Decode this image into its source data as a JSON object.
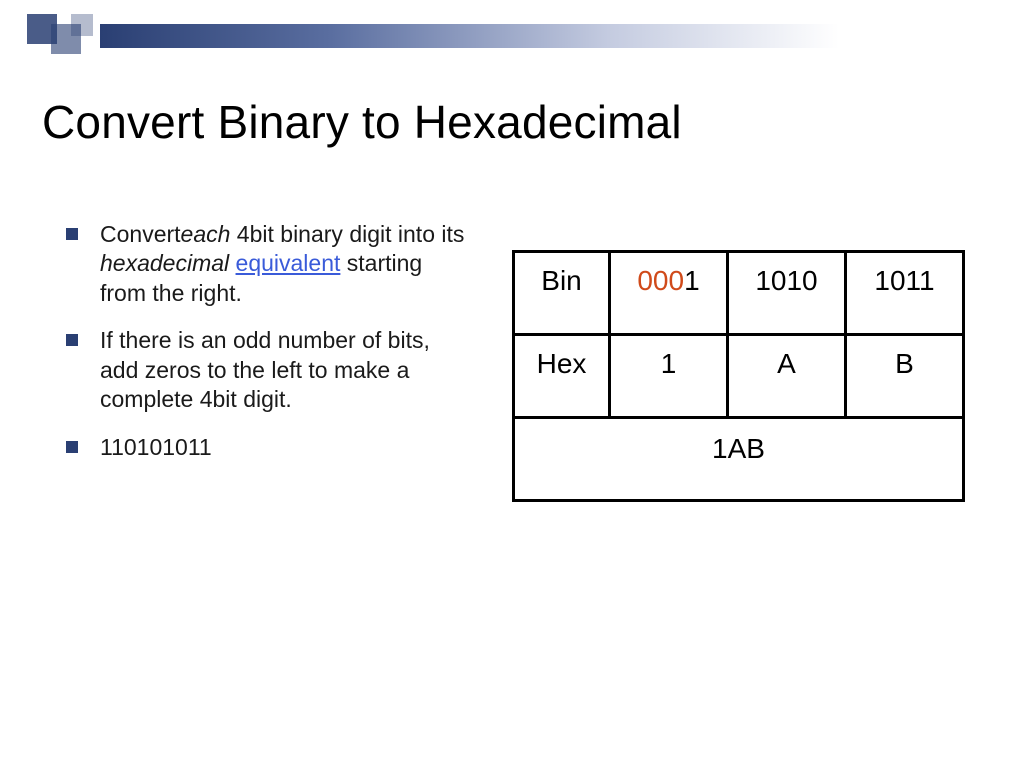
{
  "title": "Convert Binary to Hexadecimal",
  "bullets": {
    "b1": {
      "t1": "Convert",
      "t2": "each",
      "t3": " 4bit binary digit into its ",
      "t4": "hexadecimal",
      "t5": " ",
      "t6": "equivalent",
      "t7": " starting from the right."
    },
    "b2": "If there is an odd number of bits, add zeros to the left to make a complete 4bit digit.",
    "b3": "110101011"
  },
  "table": {
    "r1": {
      "label": "Bin",
      "c1_red": "000",
      "c1_rest": "1",
      "c2": "1010",
      "c3": "1011"
    },
    "r2": {
      "label": "Hex",
      "c1": "1",
      "c2": "A",
      "c3": "B"
    },
    "result": "1AB"
  }
}
